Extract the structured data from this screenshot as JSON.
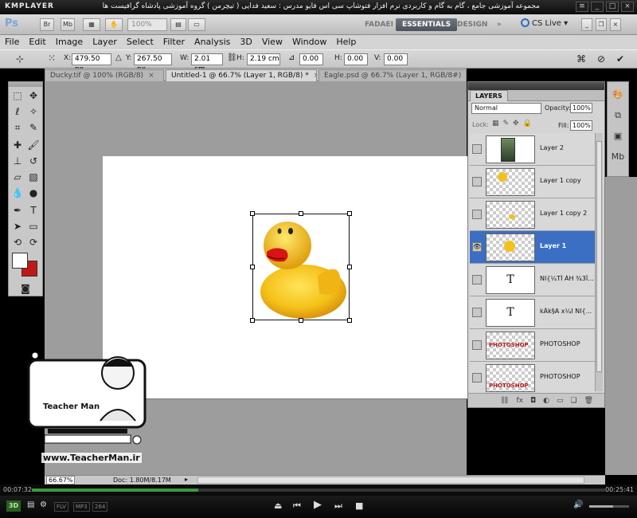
{
  "player": {
    "logo": "KMPLAYER",
    "video_title": "مجموعه آموزشی جامع ، گام به گام و کاربردی نرم افزار فتوشاپ سی اس فایو  مدرس : سعید فدایی ( تیچرمن ) گروه آموزشی پادشاه گرافیست ها",
    "time_elapsed": "00:07:32",
    "time_total": "00:25:41",
    "progress": 0.29,
    "volume": 0.6,
    "badge_3d": "3D",
    "formats": [
      "FLV",
      "MP3",
      "264"
    ]
  },
  "app": {
    "logo": "Ps",
    "zoom": "100%",
    "workspaces": [
      "FADAEI",
      "ESSENTIALS",
      "DESIGN"
    ],
    "active_workspace": "ESSENTIALS",
    "cs_live": "CS Live"
  },
  "menu": [
    "File",
    "Edit",
    "Image",
    "Layer",
    "Select",
    "Filter",
    "Analysis",
    "3D",
    "View",
    "Window",
    "Help"
  ],
  "options": {
    "x_label": "X:",
    "x": "479.50 px",
    "y_label": "Y:",
    "y": "267.50 px",
    "w_label": "W:",
    "w": "2.01 cm",
    "h_label": "H:",
    "h": "2.19 cm",
    "angle": "0.00",
    "hskew_label": "H:",
    "hskew": "0.00",
    "vskew_label": "V:",
    "vskew": "0.00"
  },
  "tabs": [
    {
      "label": "Ducky.tif @ 100% (RGB/8)",
      "active": false
    },
    {
      "label": "Untitled-1 @ 66.7% (Layer 1, RGB/8) *",
      "active": true
    },
    {
      "label": "Eagle.psd @ 66.7% (Layer 1, RGB/8#)",
      "active": false
    }
  ],
  "layers_panel": {
    "tab": "LAYERS",
    "blend_mode": "Normal",
    "opacity_label": "Opacity:",
    "opacity": "100%",
    "lock_label": "Lock:",
    "fill_label": "Fill:",
    "fill": "100%",
    "layers": [
      {
        "name": "Layer 2",
        "thumb": "eagle",
        "visible": false,
        "selected": false
      },
      {
        "name": "Layer 1 copy",
        "thumb": "duck",
        "visible": false,
        "selected": false
      },
      {
        "name": "Layer 1 copy 2",
        "thumb": "duck-small",
        "visible": false,
        "selected": false
      },
      {
        "name": "Layer 1",
        "thumb": "duck",
        "visible": true,
        "selected": true
      },
      {
        "name": "NI{¼TÎ ÁH ¾3Ï...",
        "thumb": "text",
        "visible": false,
        "selected": false
      },
      {
        "name": "kÂk§A x¼I NI{...",
        "thumb": "text",
        "visible": false,
        "selected": false
      },
      {
        "name": "PHOTOSHOP",
        "thumb": "photoshop",
        "visible": false,
        "selected": false
      },
      {
        "name": "PHOTOSHOP",
        "thumb": "photoshop",
        "visible": false,
        "selected": false
      }
    ],
    "text_thumb_glyph": "T",
    "photoshop_thumb_text": "PHOTOSHOP"
  },
  "status": {
    "zoom": "66.67%",
    "doc": "Doc: 1.80M/8.17M"
  },
  "watermark": {
    "name": "Teacher Man",
    "url": "www.TeacherMan.ir"
  },
  "colors": {
    "foreground": "#ffffff",
    "background": "#c01818",
    "selection": "#3a6fc4",
    "progress": "#3b9a3b"
  }
}
